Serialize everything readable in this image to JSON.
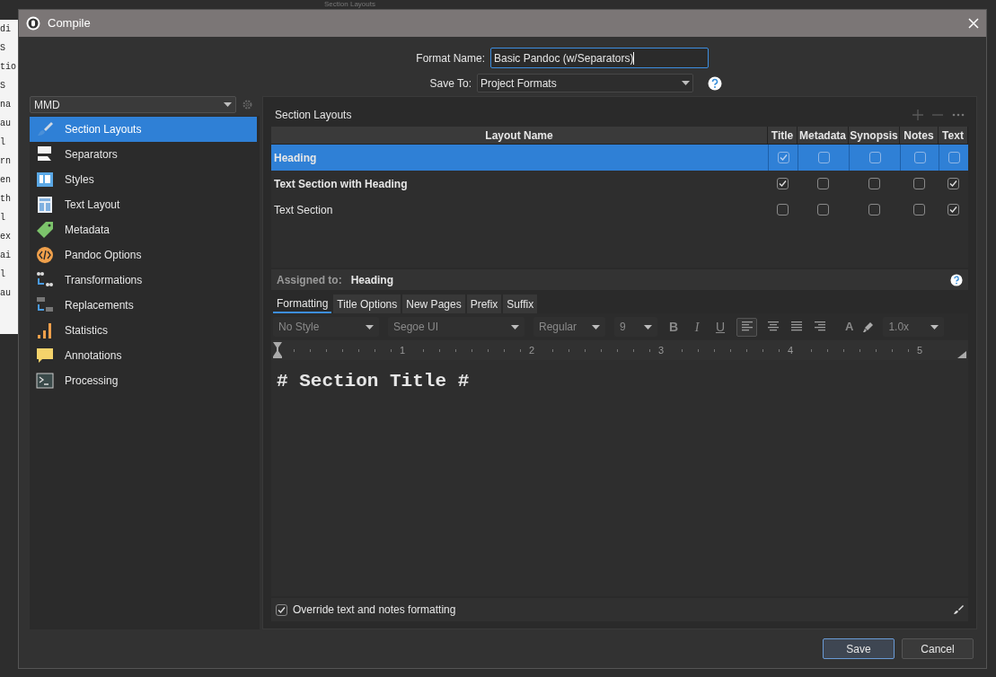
{
  "background": {
    "title": "Section Layouts",
    "editor_lines": [
      "di",
      "S",
      "tio",
      "S",
      "na",
      "au",
      "l",
      "rn",
      "en",
      "th",
      "l",
      "ex",
      "ai",
      "l",
      "au"
    ]
  },
  "window": {
    "title": "Compile"
  },
  "format_name": {
    "label": "Format Name:",
    "value": "Basic Pandoc (w/Separators)"
  },
  "save_to": {
    "label": "Save To:",
    "value": "Project Formats"
  },
  "format_select": {
    "value": "MMD"
  },
  "sidebar": {
    "items": [
      {
        "label": "Section Layouts",
        "selected": true
      },
      {
        "label": "Separators",
        "selected": false
      },
      {
        "label": "Styles",
        "selected": false
      },
      {
        "label": "Text Layout",
        "selected": false
      },
      {
        "label": "Metadata",
        "selected": false
      },
      {
        "label": "Pandoc Options",
        "selected": false
      },
      {
        "label": "Transformations",
        "selected": false
      },
      {
        "label": "Replacements",
        "selected": false
      },
      {
        "label": "Statistics",
        "selected": false
      },
      {
        "label": "Annotations",
        "selected": false
      },
      {
        "label": "Processing",
        "selected": false
      }
    ]
  },
  "panel": {
    "title": "Section Layouts"
  },
  "table": {
    "columns": [
      "Layout Name",
      "Title",
      "Metadata",
      "Synopsis",
      "Notes",
      "Text"
    ],
    "rows": [
      {
        "name": "Heading",
        "bold": true,
        "selected": true,
        "checks": [
          true,
          false,
          false,
          false,
          false
        ]
      },
      {
        "name": "Text Section with Heading",
        "bold": true,
        "selected": false,
        "checks": [
          true,
          false,
          false,
          false,
          true
        ]
      },
      {
        "name": "Text Section",
        "bold": false,
        "selected": false,
        "checks": [
          false,
          false,
          false,
          false,
          true
        ]
      }
    ]
  },
  "assigned": {
    "label": "Assigned to:",
    "value": "Heading"
  },
  "tabs": [
    {
      "label": "Formatting",
      "selected": true
    },
    {
      "label": "Title Options",
      "selected": false
    },
    {
      "label": "New Pages",
      "selected": false
    },
    {
      "label": "Prefix",
      "selected": false
    },
    {
      "label": "Suffix",
      "selected": false
    }
  ],
  "toolbar": {
    "style": "No Style",
    "font": "Segoe UI",
    "weight": "Regular",
    "size": "9",
    "bold": "B",
    "italic": "I",
    "underline": "U",
    "text_color": "A",
    "spacing": "1.0x"
  },
  "ruler": [
    "1",
    "2",
    "3",
    "4",
    "5"
  ],
  "editor": {
    "text": "# Section Title #"
  },
  "override": {
    "label": "Override text and notes formatting",
    "checked": true
  },
  "buttons": [
    "Save",
    "Cancel"
  ]
}
